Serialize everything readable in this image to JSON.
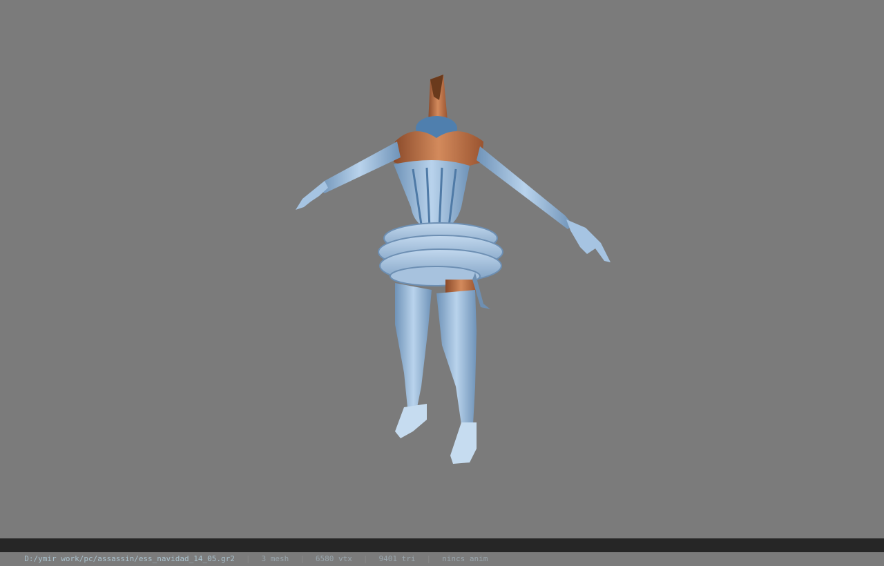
{
  "viewport": {
    "background_color": "#7b7b7b",
    "model_name": "3D character model viewport"
  },
  "statusbar": {
    "file_path": "D:/ymir work/pc/assassin/ess_navidad_14_05.gr2",
    "separator": "|",
    "mesh_count": "3 mesh",
    "vertex_count": "6580 vtx",
    "triangle_count": "9401 tri",
    "anim_status": "nincs anim"
  }
}
